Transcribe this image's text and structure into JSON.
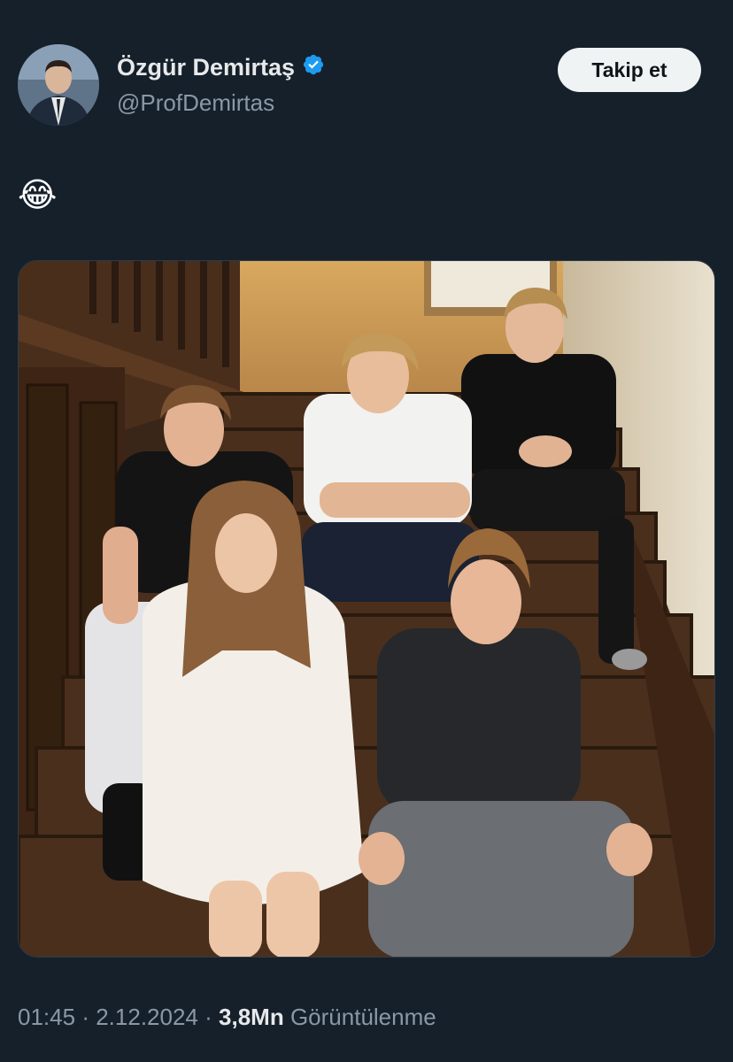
{
  "author": {
    "name": "Özgür Demirtaş",
    "handle": "@ProfDemirtas",
    "verified_icon": "verified-badge-icon",
    "verified_color": "#1d9bf0"
  },
  "follow_button": {
    "label": "Takip et"
  },
  "tweet": {
    "text": "😂",
    "media_description_icon": "family-photo-on-stairs"
  },
  "meta": {
    "time": "01:45",
    "separator1": "·",
    "date": "2.12.2024",
    "separator2": "·",
    "views_count": "3,8Mn",
    "views_label": "Görüntülenme"
  },
  "colors": {
    "background": "#15202b",
    "primary_text": "#e7e9ea",
    "secondary_text": "#8b98a5"
  }
}
